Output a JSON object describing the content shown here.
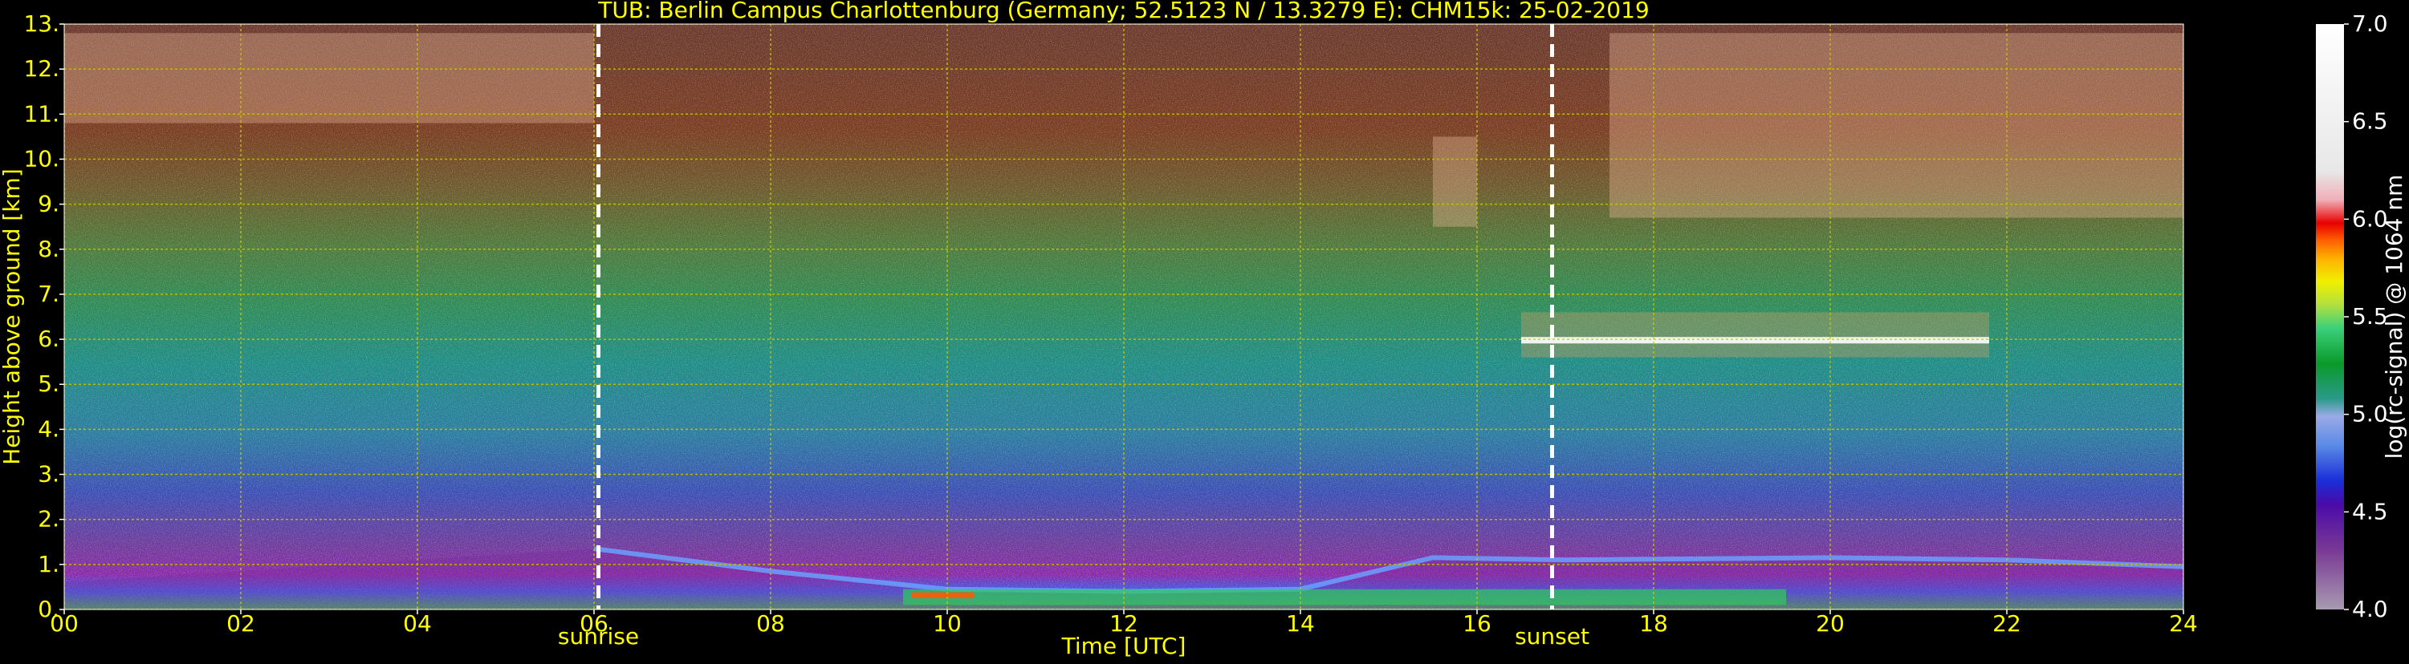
{
  "chart_data": {
    "type": "heatmap",
    "title": "TUB: Berlin Campus Charlottenburg (Germany; 52.5123 N / 13.3279 E):    CHM15k: 25-02-2019",
    "xlabel": "Time [UTC]",
    "ylabel": "Height above ground [km]",
    "xlim": [
      0,
      24
    ],
    "ylim": [
      0,
      13
    ],
    "x_ticks": [
      "00",
      "02",
      "04",
      "06",
      "08",
      "10",
      "12",
      "14",
      "16",
      "18",
      "20",
      "22",
      "24"
    ],
    "y_ticks": [
      "0.",
      "1.",
      "2.",
      "3.",
      "4.",
      "5.",
      "6.",
      "7.",
      "8.",
      "9.",
      "10.",
      "11.",
      "12.",
      "13."
    ],
    "grid": true,
    "annotations": [
      {
        "label": "sunrise",
        "x": 6.05
      },
      {
        "label": "sunset",
        "x": 16.85
      }
    ],
    "colorbar": {
      "label": "log(rc-signal) @ 1064 nm",
      "range": [
        4.0,
        7.0
      ],
      "ticks": [
        "4.0",
        "4.5",
        "5.0",
        "5.5",
        "6.0",
        "6.5",
        "7.0"
      ]
    },
    "colors": {
      "axis_text": "#ffff00",
      "grid": "#c8c800",
      "annotation_line": "#ffffff",
      "background": "#000000"
    },
    "features": {
      "boundary_layer_top_km": [
        [
          6.0,
          1.35
        ],
        [
          8.0,
          0.85
        ],
        [
          10.0,
          0.45
        ],
        [
          12.0,
          0.4
        ],
        [
          14.0,
          0.45
        ],
        [
          15.5,
          1.15
        ],
        [
          17.0,
          1.1
        ],
        [
          20.0,
          1.15
        ],
        [
          22.0,
          1.1
        ],
        [
          24.0,
          0.95
        ]
      ],
      "mid_cloud": {
        "x_start": 16.5,
        "x_end": 21.8,
        "base_km": 5.6,
        "top_km": 6.6
      },
      "cirrus_layers": [
        {
          "x_start": 0.0,
          "x_end": 6.0,
          "base_km": 10.8,
          "top_km": 12.8
        },
        {
          "x_start": 15.5,
          "x_end": 16.0,
          "base_km": 8.5,
          "top_km": 10.5
        },
        {
          "x_start": 17.5,
          "x_end": 24.0,
          "base_km": 8.7,
          "top_km": 12.8
        }
      ]
    }
  }
}
